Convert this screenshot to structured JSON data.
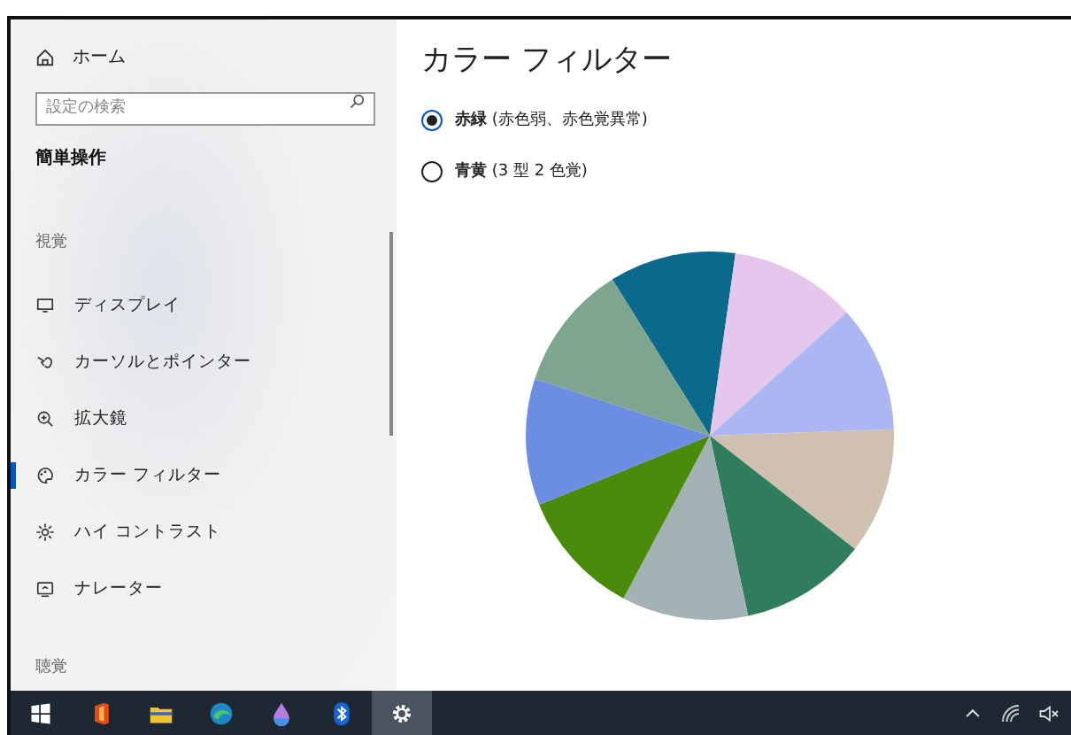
{
  "sidebar": {
    "home": {
      "label": "ホーム"
    },
    "search": {
      "placeholder": "設定の検索"
    },
    "title": "簡単操作",
    "groups": [
      {
        "heading": "視覚",
        "items": [
          {
            "label": "ディスプレイ",
            "selected": false
          },
          {
            "label": "カーソルとポインター",
            "selected": false
          },
          {
            "label": "拡大鏡",
            "selected": false
          },
          {
            "label": "カラー フィルター",
            "selected": true
          },
          {
            "label": "ハイ コントラスト",
            "selected": false
          },
          {
            "label": "ナレーター",
            "selected": false
          }
        ]
      },
      {
        "heading": "聴覚"
      }
    ]
  },
  "content": {
    "title": "カラー フィルター",
    "options": [
      {
        "label": "**赤緑** (赤色弱、赤色覚異常)",
        "selected": true
      },
      {
        "label": "**青黄** (3 型 2 色覚)",
        "selected": false
      }
    ]
  },
  "taskbar": {
    "apps": [
      {
        "selected": false
      },
      {
        "selected": false
      },
      {
        "selected": false
      },
      {
        "selected": false
      },
      {
        "selected": false
      },
      {
        "selected": false
      },
      {
        "selected": true
      }
    ]
  }
}
